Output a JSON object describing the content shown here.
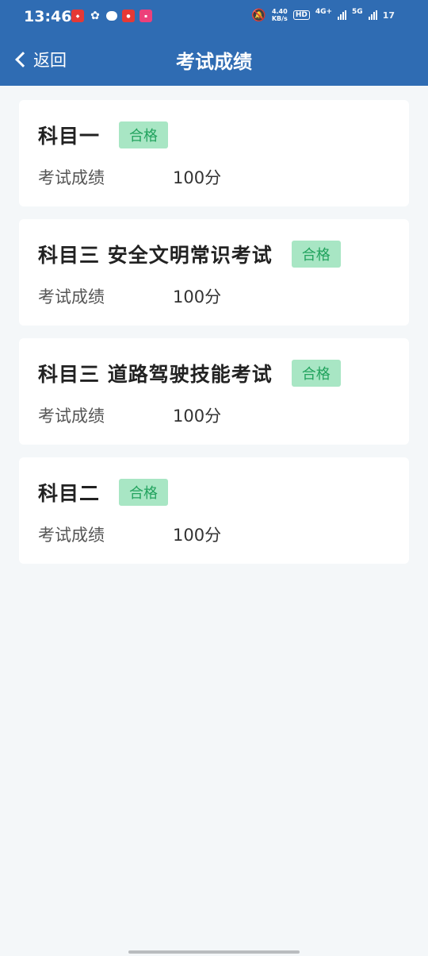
{
  "status_bar": {
    "time": "13:46",
    "net_speed_value": "4.40",
    "net_speed_unit": "KB/s",
    "hd_label": "HD",
    "net1": "4G+",
    "net2": "5G",
    "battery": "17"
  },
  "nav": {
    "back_label": "返回",
    "title": "考试成绩"
  },
  "records": [
    {
      "subject": "科目一",
      "status": "合格",
      "score_label": "考试成绩",
      "score": "100分"
    },
    {
      "subject": "科目三 安全文明常识考试",
      "status": "合格",
      "score_label": "考试成绩",
      "score": "100分"
    },
    {
      "subject": "科目三 道路驾驶技能考试",
      "status": "合格",
      "score_label": "考试成绩",
      "score": "100分"
    },
    {
      "subject": "科目二",
      "status": "合格",
      "score_label": "考试成绩",
      "score": "100分"
    }
  ],
  "colors": {
    "header_bg": "#2f6cb3",
    "badge_bg": "#a8e6c4",
    "badge_text": "#22a35e",
    "page_bg": "#f4f7f9"
  }
}
